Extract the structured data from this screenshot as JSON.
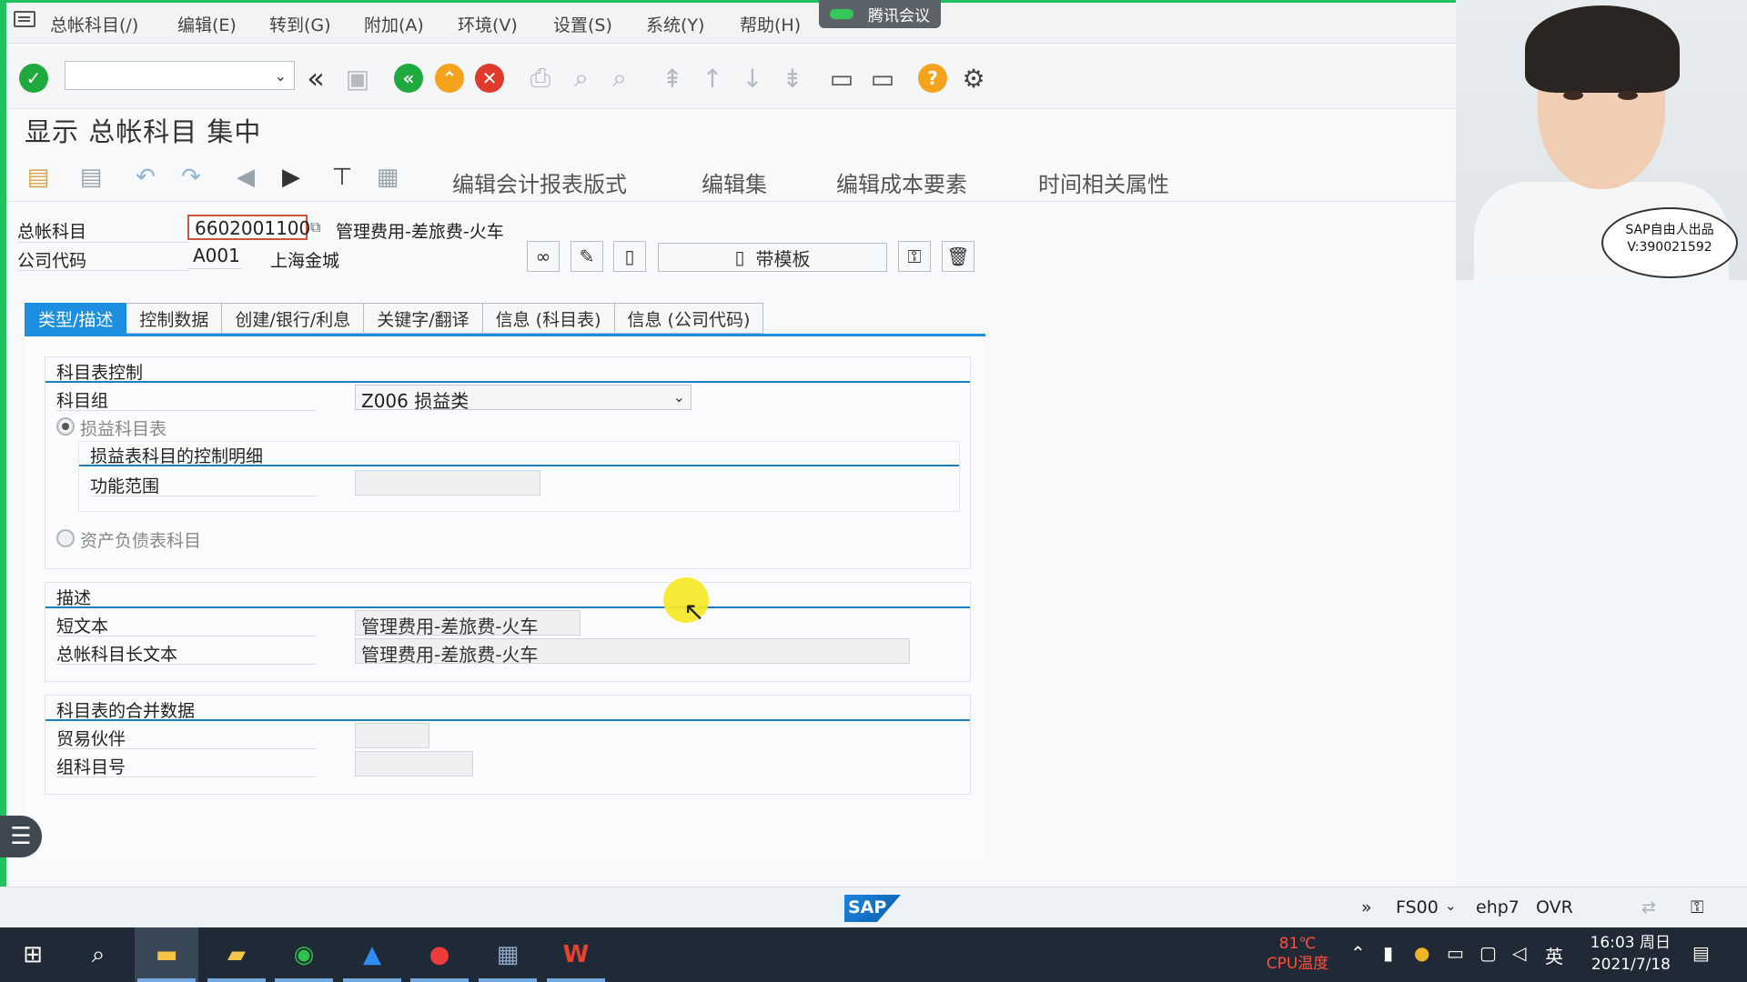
{
  "menu": {
    "items": [
      "总帐科目(/)",
      "编辑(E)",
      "转到(G)",
      "附加(A)",
      "环境(V)",
      "设置(S)",
      "系统(Y)",
      "帮助(H)"
    ],
    "meeting_badge": "腾讯会议"
  },
  "toolbar": {
    "command_field": ""
  },
  "page_title": "显示 总帐科目 集中",
  "app_toolbar": {
    "buttons": [
      "编辑会计报表版式",
      "编辑集",
      "编辑成本要素",
      "时间相关属性"
    ]
  },
  "header": {
    "gl_account_label": "总帐科目",
    "gl_account_value": "6602001100",
    "gl_account_desc": "管理费用-差旅费-火车",
    "company_code_label": "公司代码",
    "company_code_value": "A001",
    "company_name": "上海金城",
    "template_button_label": "带模板"
  },
  "tabs": [
    "类型/描述",
    "控制数据",
    "创建/银行/利息",
    "关键字/翻译",
    "信息 (科目表)",
    "信息 (公司代码)"
  ],
  "chart_control": {
    "title": "科目表控制",
    "account_group_label": "科目组",
    "account_group_value": "Z006 损益类",
    "pl_radio_label": "损益科目表",
    "pl_detail_title": "损益表科目的控制明细",
    "functional_area_label": "功能范围",
    "functional_area_value": "",
    "bs_radio_label": "资产负债表科目"
  },
  "description": {
    "title": "描述",
    "short_text_label": "短文本",
    "short_text_value": "管理费用-差旅费-火车",
    "long_text_label": "总帐科目长文本",
    "long_text_value": "管理费用-差旅费-火车"
  },
  "consolidation": {
    "title": "科目表的合并数据",
    "trading_partner_label": "贸易伙伴",
    "trading_partner_value": "",
    "group_account_label": "组科目号",
    "group_account_value": ""
  },
  "status_bar": {
    "transaction": "FS00",
    "system": "ehp7",
    "mode": "OVR",
    "logo": "SAP"
  },
  "webcam": {
    "bubble_line1": "SAP自由人出品",
    "bubble_line2": "V:390021592"
  },
  "taskbar": {
    "cpu_temp": "81℃",
    "cpu_label": "CPU温度",
    "ime": "英",
    "time": "16:03 周日",
    "date": "2021/7/18"
  }
}
